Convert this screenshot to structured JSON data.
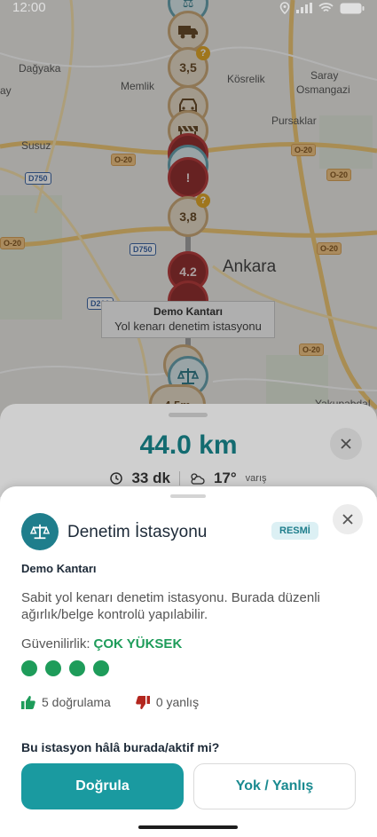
{
  "status_bar": {
    "time": "12:00"
  },
  "map": {
    "places": [
      "Dağyaka",
      "Memlik",
      "Kösrelik",
      "Saray",
      "Osmangazi",
      "Pursaklar",
      "Susuz",
      "Ankara",
      "Yakupabdal",
      "ay"
    ],
    "road_shields": [
      "O-20",
      "O-20",
      "O-20",
      "O-20",
      "O-20",
      "D750",
      "D750",
      "D200",
      "O-20"
    ],
    "markers": [
      {
        "label": "3,5",
        "style": "cream"
      },
      {
        "label": "3,8",
        "style": "cream"
      },
      {
        "label": "4.2",
        "style": "red"
      },
      {
        "label": "4.5m",
        "style": "cream"
      }
    ],
    "tooltip": {
      "title": "Demo Kantarı",
      "subtitle": "Yol kenarı denetim istasyonu"
    }
  },
  "route_panel": {
    "distance": "44.0 km",
    "duration": "33 dk",
    "temperature": "17°",
    "temperature_suffix": "varış"
  },
  "sheet": {
    "title": "Denetim İstasyonu",
    "badge": "RESMİ",
    "station_name": "Demo Kantarı",
    "description": "Sabit yol kenarı denetim istasyonu. Burada düzenli ağırlık/belge kontrolü yapılabilir.",
    "reliability_label": "Güvenilirlik:",
    "reliability_value": "ÇOK YÜKSEK",
    "reliability_level": 4,
    "confirmations": "5 doğrulama",
    "wrong_reports": "0 yanlış",
    "question": "Bu istasyon hâlâ burada/aktif mi?",
    "confirm_button": "Doğrula",
    "reject_button": "Yok / Yanlış"
  },
  "colors": {
    "accent": "#1a9aa0",
    "success": "#1e9c5a",
    "danger": "#b3261e",
    "route_distance": "#167a80"
  }
}
